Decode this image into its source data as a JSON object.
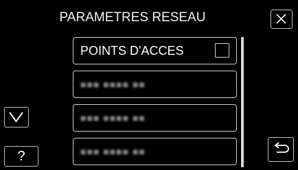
{
  "header": {
    "title": "PARAMETRES RESEAU"
  },
  "buttons": {
    "close_icon": "close-icon",
    "scroll_down_icon": "chevron-down-icon",
    "help_label": "?",
    "back_icon": "return-arrow-icon"
  },
  "list": {
    "items": [
      {
        "label": "POINTS D'ACCES",
        "checked": false
      },
      {
        "label": "■■■ ■■■■ ■■"
      },
      {
        "label": "■■■ ■■■■ ■■"
      },
      {
        "label": "■■■ ■■■■ ■■"
      }
    ]
  },
  "colors": {
    "background": "#000000",
    "border": "#cfcfcf",
    "text": "#ffffff"
  }
}
